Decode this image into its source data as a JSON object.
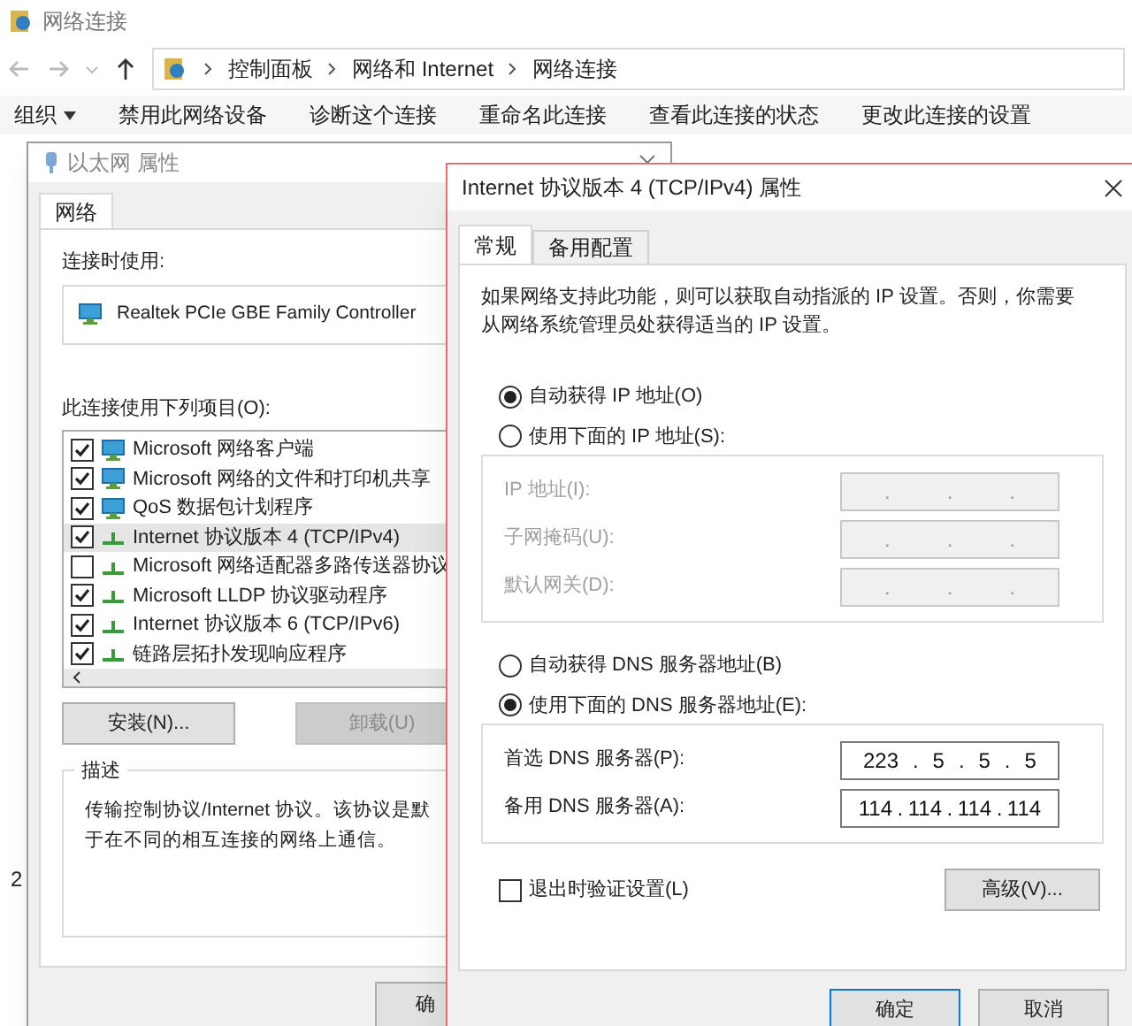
{
  "explorer": {
    "title": "网络连接",
    "breadcrumb": [
      "控制面板",
      "网络和 Internet",
      "网络连接"
    ],
    "toolbar": [
      {
        "label": "组织",
        "dropdown": true
      },
      {
        "label": "禁用此网络设备",
        "dropdown": false
      },
      {
        "label": "诊断这个连接",
        "dropdown": false
      },
      {
        "label": "重命名此连接",
        "dropdown": false
      },
      {
        "label": "查看此连接的状态",
        "dropdown": false
      },
      {
        "label": "更改此连接的设置",
        "dropdown": false
      }
    ],
    "side_text": "2"
  },
  "ethernet_dialog": {
    "title": "以太网 属性",
    "tabs": [
      {
        "label": "网络",
        "selected": true
      }
    ],
    "connect_using_label": "连接时使用:",
    "adapter": "Realtek PCIe GBE Family Controller",
    "items_label": "此连接使用下列项目(O):",
    "items": [
      {
        "label": "Microsoft 网络客户端",
        "checked": true,
        "selected": false,
        "kind": "client"
      },
      {
        "label": "Microsoft 网络的文件和打印机共享",
        "checked": true,
        "selected": false,
        "kind": "client"
      },
      {
        "label": "QoS 数据包计划程序",
        "checked": true,
        "selected": false,
        "kind": "client"
      },
      {
        "label": "Internet 协议版本 4 (TCP/IPv4)",
        "checked": true,
        "selected": true,
        "kind": "protocol"
      },
      {
        "label": "Microsoft 网络适配器多路传送器协议",
        "checked": false,
        "selected": false,
        "kind": "protocol"
      },
      {
        "label": "Microsoft LLDP 协议驱动程序",
        "checked": true,
        "selected": false,
        "kind": "protocol"
      },
      {
        "label": "Internet 协议版本 6 (TCP/IPv6)",
        "checked": true,
        "selected": false,
        "kind": "protocol"
      },
      {
        "label": "链路层拓扑发现响应程序",
        "checked": true,
        "selected": false,
        "kind": "protocol"
      }
    ],
    "buttons": [
      {
        "label": "安装(N)...",
        "disabled": false
      },
      {
        "label": "卸载(U)",
        "disabled": true
      }
    ],
    "description_title": "描述",
    "description": [
      "传输控制协议/Internet 协议。该协议是默",
      "于在不同的相互连接的网络上通信。"
    ],
    "footer_button": "确"
  },
  "ipv4_dialog": {
    "title": "Internet 协议版本 4 (TCP/IPv4) 属性",
    "tabs": [
      {
        "label": "常规",
        "selected": true
      },
      {
        "label": "备用配置",
        "selected": false
      }
    ],
    "intro": "如果网络支持此功能，则可以获取自动指派的 IP 设置。否则，你需要从网络系统管理员处获得适当的 IP 设置。",
    "ip_mode": [
      {
        "label": "自动获得 IP 地址(O)",
        "selected": true
      },
      {
        "label": "使用下面的 IP 地址(S):",
        "selected": false
      }
    ],
    "ip_fields": [
      {
        "label": "IP 地址(I):",
        "disabled": true,
        "parts": [
          ".",
          ".",
          "."
        ]
      },
      {
        "label": "子网掩码(U):",
        "disabled": true,
        "parts": [
          ".",
          ".",
          "."
        ]
      },
      {
        "label": "默认网关(D):",
        "disabled": true,
        "parts": [
          ".",
          ".",
          "."
        ]
      }
    ],
    "dns_mode": [
      {
        "label": "自动获得 DNS 服务器地址(B)",
        "selected": false
      },
      {
        "label": "使用下面的 DNS 服务器地址(E):",
        "selected": true
      }
    ],
    "dns_fields": [
      {
        "label": "首选 DNS 服务器(P):",
        "disabled": false,
        "parts": [
          "223",
          ".",
          "5",
          ".",
          "5",
          ".",
          "5"
        ]
      },
      {
        "label": "备用 DNS 服务器(A):",
        "disabled": false,
        "parts": [
          "114",
          ".",
          "114",
          ".",
          "114",
          ".",
          "114"
        ]
      }
    ],
    "validate": {
      "label": "退出时验证设置(L)",
      "checked": false
    },
    "advanced_button": "高级(V)...",
    "buttons": [
      "确定",
      "取消"
    ]
  }
}
